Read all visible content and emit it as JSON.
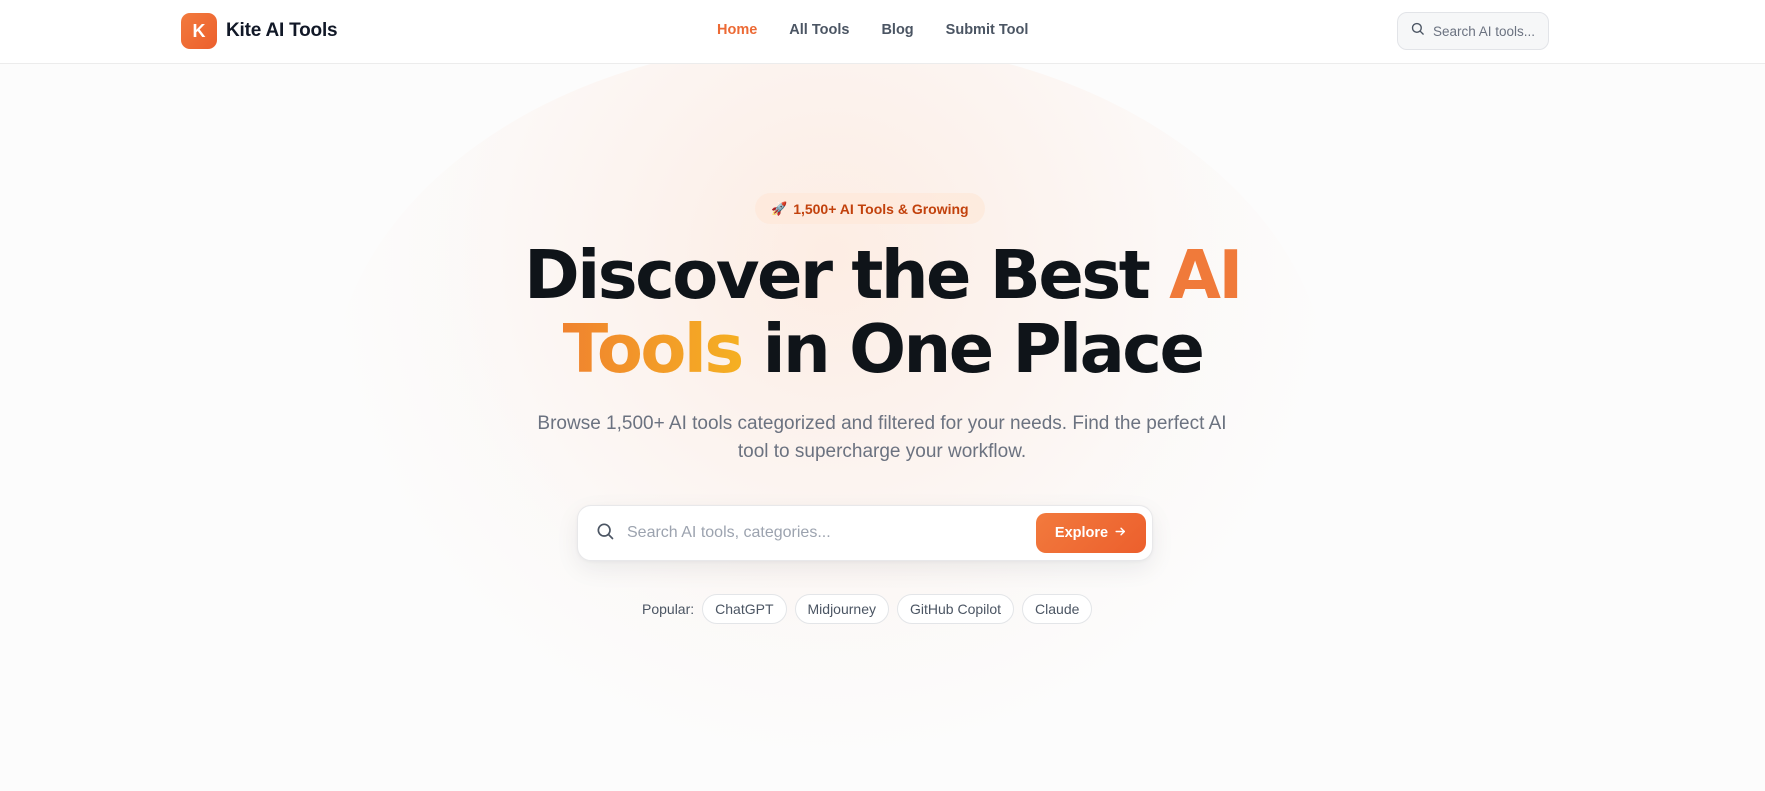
{
  "brand": {
    "logo_letter": "K",
    "name": "Kite AI Tools",
    "accent_color": "#ec6a35"
  },
  "nav": {
    "items": [
      {
        "label": "Home",
        "active": true
      },
      {
        "label": "All Tools",
        "active": false
      },
      {
        "label": "Blog",
        "active": false
      },
      {
        "label": "Submit Tool",
        "active": false
      }
    ]
  },
  "header_search": {
    "placeholder": "Search AI tools..."
  },
  "hero": {
    "badge_icon": "rocket-icon",
    "badge_text": "1,500+ AI Tools & Growing",
    "headline_part1": "Discover the Best ",
    "headline_accent1": "AI",
    "headline_accent2": "Tools",
    "headline_part2": " in One Place",
    "subtitle": "Browse 1,500+ AI tools categorized and filtered for your needs. Find the perfect AI tool to supercharge your workflow.",
    "search_placeholder": "Search AI tools, categories...",
    "explore_label": "Explore",
    "popular_label": "Popular:",
    "popular_tags": [
      "ChatGPT",
      "Midjourney",
      "GitHub Copilot",
      "Claude"
    ]
  }
}
